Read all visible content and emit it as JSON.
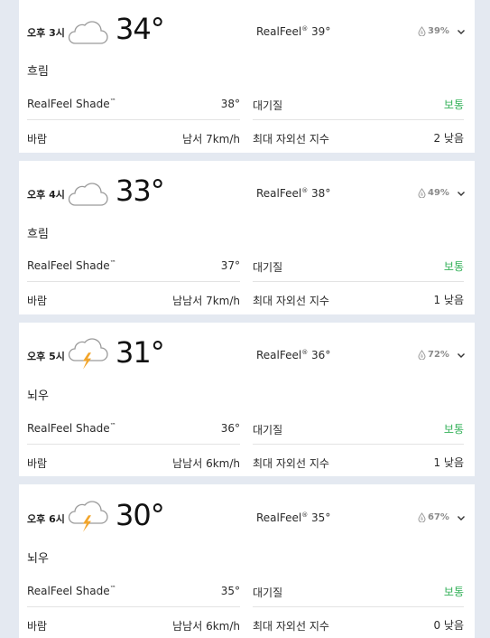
{
  "colors": {
    "background": "#e4e9f1",
    "card": "#ffffff",
    "good": "#35b15a",
    "lightning": "#f2a52b",
    "cloud_stroke": "#9a9a9a"
  },
  "labels": {
    "realfeel_prefix": "RealFeel",
    "realfeel_mark": "®",
    "shade_label": "RealFeel Shade",
    "shade_mark": "™",
    "air_quality": "대기질",
    "wind": "바람",
    "uv_index": "최대 자외선 지수"
  },
  "hours": [
    {
      "time": "오후 3시",
      "icon": "cloudy-icon",
      "temp": "34°",
      "realfeel": "39°",
      "precip": "39%",
      "phrase": "흐림",
      "shade": "38°",
      "air_quality": "보통",
      "wind": "남서 7km/h",
      "uv": "2 낮음"
    },
    {
      "time": "오후 4시",
      "icon": "cloudy-icon",
      "temp": "33°",
      "realfeel": "38°",
      "precip": "49%",
      "phrase": "흐림",
      "shade": "37°",
      "air_quality": "보통",
      "wind": "남남서 7km/h",
      "uv": "1 낮음"
    },
    {
      "time": "오후 5시",
      "icon": "thunderstorm-icon",
      "temp": "31°",
      "realfeel": "36°",
      "precip": "72%",
      "phrase": "뇌우",
      "shade": "36°",
      "air_quality": "보통",
      "wind": "남남서 6km/h",
      "uv": "1 낮음"
    },
    {
      "time": "오후 6시",
      "icon": "thunderstorm-icon",
      "temp": "30°",
      "realfeel": "35°",
      "precip": "67%",
      "phrase": "뇌우",
      "shade": "35°",
      "air_quality": "보통",
      "wind": "남남서 6km/h",
      "uv": "0 낮음"
    }
  ]
}
